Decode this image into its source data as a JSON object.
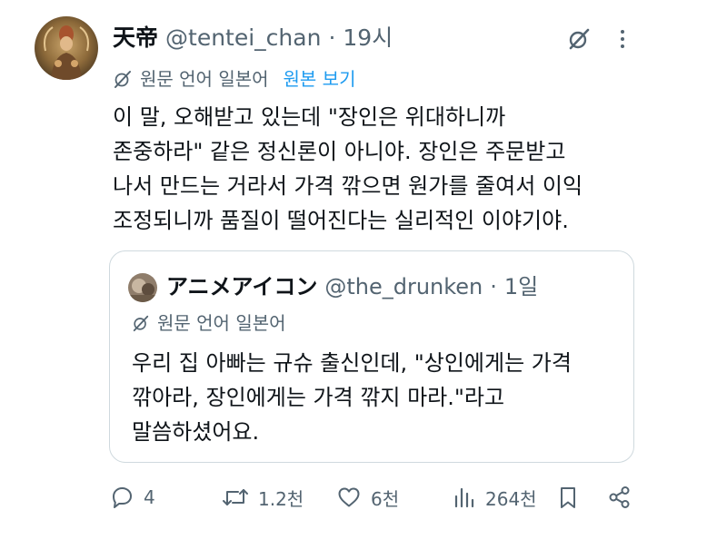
{
  "tweet": {
    "display_name": "天帝",
    "handle": "@tentei_chan",
    "separator": "·",
    "time": "19시",
    "translation": {
      "label": "원문 언어 일본어",
      "show_original": "원본 보기"
    },
    "body_lines": [
      "이 말, 오해받고 있는데 \"장인은 위대하니까",
      "존중하라\" 같은 정신론이 아니야. 장인은 주문받고",
      "나서 만드는 거라서 가격 깎으면 원가를 줄여서 이익",
      "조정되니까 품질이 떨어진다는 실리적인 이야기야."
    ]
  },
  "quote": {
    "display_name": "アニメアイコン",
    "handle": "@the_drunken",
    "separator": "·",
    "time": "1일",
    "translation_label": "원문 언어 일본어",
    "body_lines": [
      "우리 집 아빠는 규슈 출신인데, \"상인에게는 가격",
      "깎아라, 장인에게는 가격 깎지 마라.\"라고",
      "말씀하셨어요."
    ]
  },
  "actions": {
    "reply": {
      "icon": "reply-icon",
      "count": "4"
    },
    "retweet": {
      "icon": "retweet-icon",
      "count": "1.2천"
    },
    "like": {
      "icon": "heart-icon",
      "count": "6천"
    },
    "views": {
      "icon": "views-icon",
      "count": "264천"
    },
    "bookmark": {
      "icon": "bookmark-icon"
    },
    "share": {
      "icon": "share-icon"
    }
  },
  "colors": {
    "text": "#0f1419",
    "secondary": "#536471",
    "link": "#1d9bf0",
    "border": "#cfd9de"
  }
}
